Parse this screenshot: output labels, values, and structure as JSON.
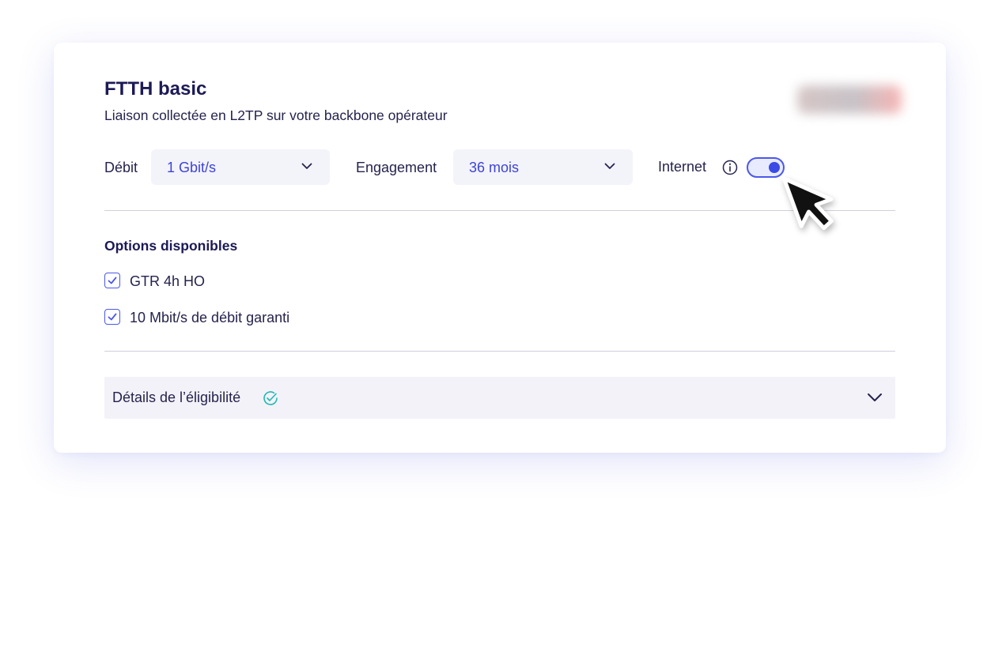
{
  "card": {
    "title": "FTTH basic",
    "subtitle": "Liaison collectée en L2TP sur votre backbone opérateur"
  },
  "config": {
    "debit": {
      "label": "Débit",
      "selected": "1 Gbit/s"
    },
    "engagement": {
      "label": "Engagement",
      "selected": "36 mois"
    },
    "internet": {
      "label": "Internet",
      "toggle_on": true
    }
  },
  "options": {
    "title": "Options disponibles",
    "items": [
      {
        "label": "GTR 4h HO",
        "checked": true
      },
      {
        "label": "10 Mbit/s de débit garanti",
        "checked": true
      }
    ]
  },
  "eligibility": {
    "label": "Détails de l’éligibilité"
  },
  "colors": {
    "accent": "#3d45d6",
    "heading": "#1c1a55",
    "text": "#25234d",
    "field_bg": "#f3f3fa",
    "success": "#22b8b0"
  },
  "icons": {
    "info": "info-icon",
    "chevron": "chevron-down-icon",
    "check": "check-icon",
    "check_circle": "check-circle-icon",
    "cursor": "mouse-pointer-icon"
  }
}
